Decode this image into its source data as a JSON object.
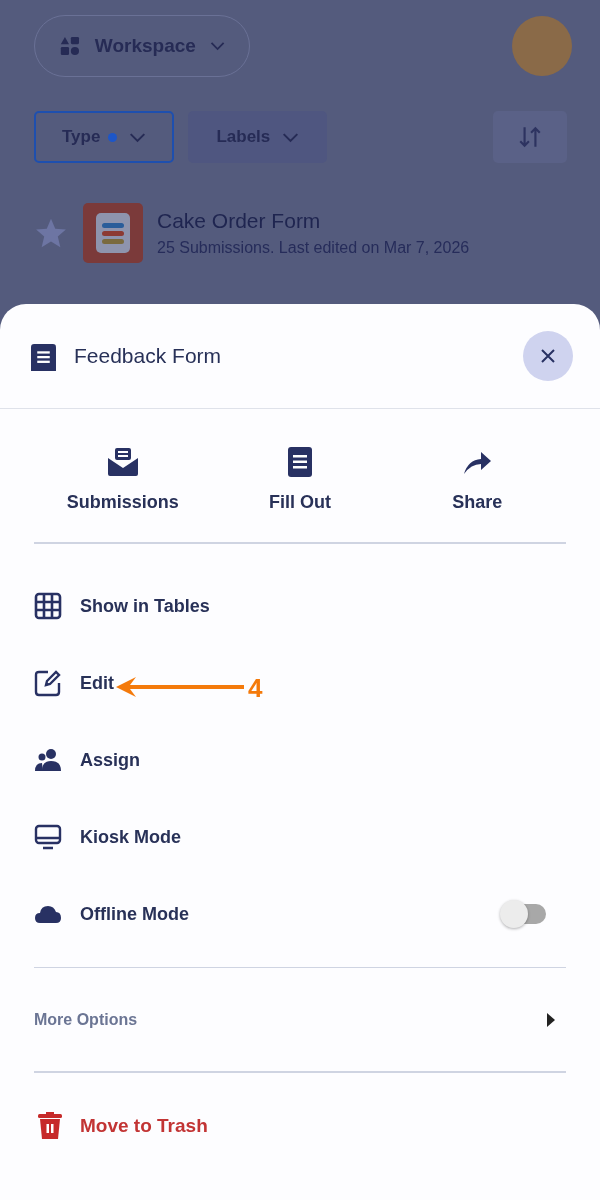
{
  "header": {
    "workspace": "Workspace"
  },
  "filters": [
    {
      "label": "Type",
      "active": true
    },
    {
      "label": "Labels",
      "active": false
    }
  ],
  "forms": [
    {
      "title": "Cake Order Form",
      "subtitle": "25 Submissions. Last edited on Mar 7, 2026",
      "starred": false
    }
  ],
  "sheet": {
    "title": "Feedback Form",
    "actions": [
      {
        "kind": "submissions",
        "label": "Submissions"
      },
      {
        "kind": "fill",
        "label": "Fill Out"
      },
      {
        "kind": "share",
        "label": "Share"
      }
    ],
    "items": [
      {
        "kind": "table",
        "label": "Show in Tables"
      },
      {
        "kind": "edit",
        "label": "Edit"
      },
      {
        "kind": "assign",
        "label": "Assign"
      },
      {
        "kind": "kiosk",
        "label": "Kiosk Mode"
      },
      {
        "kind": "offline",
        "label": "Offline Mode",
        "on": false
      }
    ],
    "more_options": "More Options",
    "trash": "Move to Trash"
  },
  "annotation": {
    "label": "4"
  }
}
